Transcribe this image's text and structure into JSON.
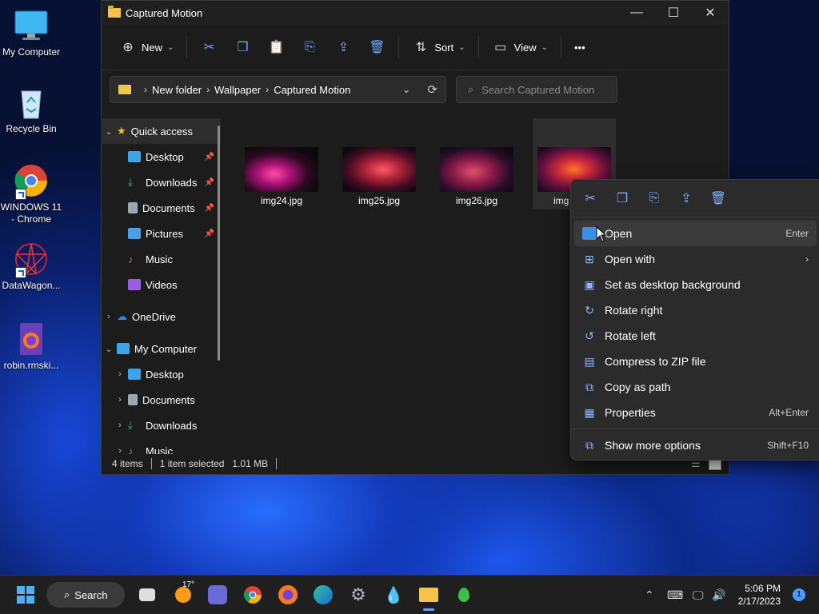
{
  "desktop": {
    "icons": [
      {
        "label": "My Computer"
      },
      {
        "label": "Recycle Bin"
      },
      {
        "label": "WINDOWS 11 - Chrome"
      },
      {
        "label": "DataWagon..."
      },
      {
        "label": "robin.rmski..."
      }
    ]
  },
  "window": {
    "title": "Captured Motion",
    "controls": {
      "minimize": "—",
      "maximize": "☐",
      "close": "✕"
    },
    "toolbar": {
      "new_label": "New",
      "sort_label": "Sort",
      "view_label": "View",
      "more_label": "•••"
    },
    "breadcrumbs": [
      "New folder",
      "Wallpaper",
      "Captured Motion"
    ],
    "search": {
      "placeholder": "Search Captured Motion"
    },
    "sidebar": {
      "quick_access": "Quick access",
      "quick_items": [
        {
          "label": "Desktop",
          "pinned": true
        },
        {
          "label": "Downloads",
          "pinned": true
        },
        {
          "label": "Documents",
          "pinned": true
        },
        {
          "label": "Pictures",
          "pinned": true
        },
        {
          "label": "Music",
          "pinned": false
        },
        {
          "label": "Videos",
          "pinned": false
        }
      ],
      "onedrive": "OneDrive",
      "my_computer": "My Computer",
      "pc_items": [
        "Desktop",
        "Documents",
        "Downloads",
        "Music"
      ]
    },
    "files": [
      {
        "name": "img24.jpg"
      },
      {
        "name": "img25.jpg"
      },
      {
        "name": "img26.jpg"
      },
      {
        "name": "img"
      }
    ],
    "status": {
      "items": "4 items",
      "selected": "1 item selected",
      "size": "1.01 MB"
    }
  },
  "context_menu": {
    "items": [
      {
        "label": "Open",
        "shortcut": "Enter"
      },
      {
        "label": "Open with",
        "shortcut": ""
      },
      {
        "label": "Set as desktop background",
        "shortcut": ""
      },
      {
        "label": "Rotate right",
        "shortcut": ""
      },
      {
        "label": "Rotate left",
        "shortcut": ""
      },
      {
        "label": "Compress to ZIP file",
        "shortcut": ""
      },
      {
        "label": "Copy as path",
        "shortcut": ""
      },
      {
        "label": "Properties",
        "shortcut": "Alt+Enter"
      }
    ],
    "more": {
      "label": "Show more options",
      "shortcut": "Shift+F10"
    }
  },
  "taskbar": {
    "search_label": "Search",
    "weather_temp": "17°",
    "clock_time": "5:06 PM",
    "clock_date": "2/17/2023",
    "notification_count": "1"
  },
  "colors": {
    "accent": "#4d9bff",
    "folder": "#f4c54a"
  }
}
